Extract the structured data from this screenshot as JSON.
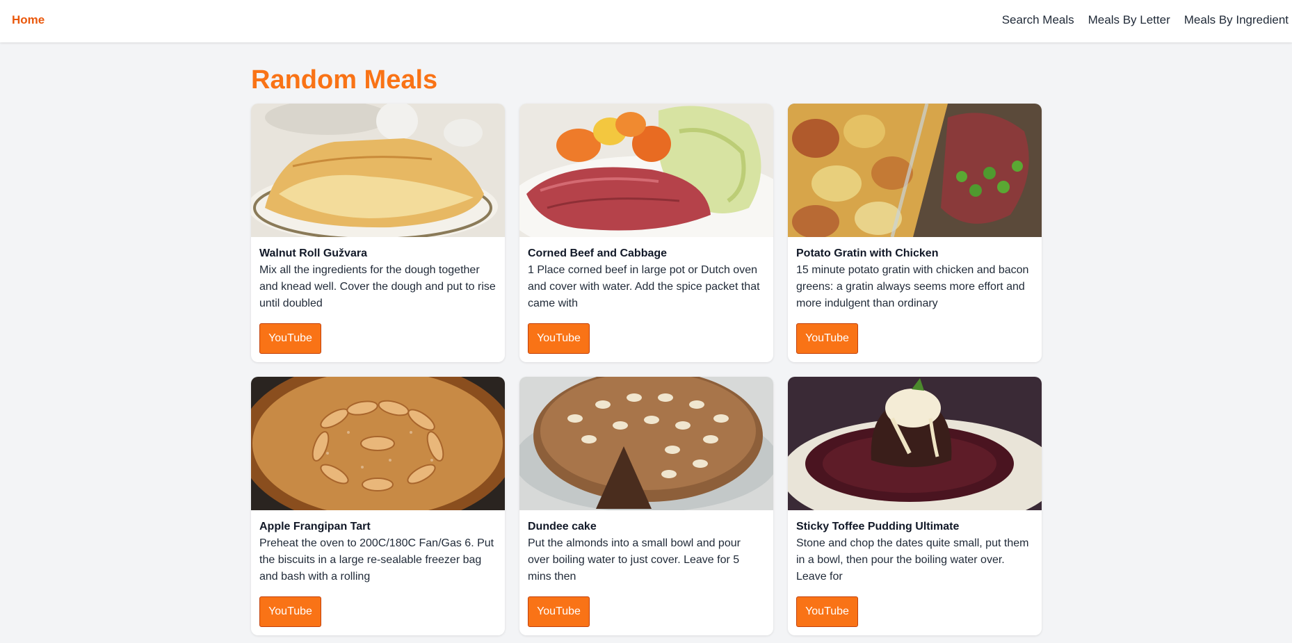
{
  "nav": {
    "home": "Home",
    "links": [
      "Search Meals",
      "Meals By Letter",
      "Meals By Ingredient"
    ]
  },
  "page_title": "Random Meals",
  "colors": {
    "accent": "#f97316",
    "background": "#f3f4f6"
  },
  "meals": [
    {
      "name": "Walnut Roll Gužvara",
      "description": "Mix all the ingredients for the dough together and knead well. Cover the dough and put to rise until doubled",
      "button": "YouTube",
      "image": "walnut-roll-photo"
    },
    {
      "name": "Corned Beef and Cabbage",
      "description": "1 Place corned beef in large pot or Dutch oven and cover with water. Add the spice packet that came with",
      "button": "YouTube",
      "image": "corned-beef-photo"
    },
    {
      "name": "Potato Gratin with Chicken",
      "description": "15 minute potato gratin with chicken and bacon greens: a gratin always seems more effort and more indulgent than ordinary",
      "button": "YouTube",
      "image": "potato-gratin-photo"
    },
    {
      "name": "Apple Frangipan Tart",
      "description": "Preheat the oven to 200C/180C Fan/Gas 6. Put the biscuits in a large re-sealable freezer bag and bash with a rolling",
      "button": "YouTube",
      "image": "apple-tart-photo"
    },
    {
      "name": "Dundee cake",
      "description": "Put the almonds into a small bowl and pour over boiling water to just cover. Leave for 5 mins then",
      "button": "YouTube",
      "image": "dundee-cake-photo"
    },
    {
      "name": "Sticky Toffee Pudding Ultimate",
      "description": "Stone and chop the dates quite small, put them in a bowl, then pour the boiling water over. Leave for",
      "button": "YouTube",
      "image": "sticky-toffee-photo"
    }
  ]
}
